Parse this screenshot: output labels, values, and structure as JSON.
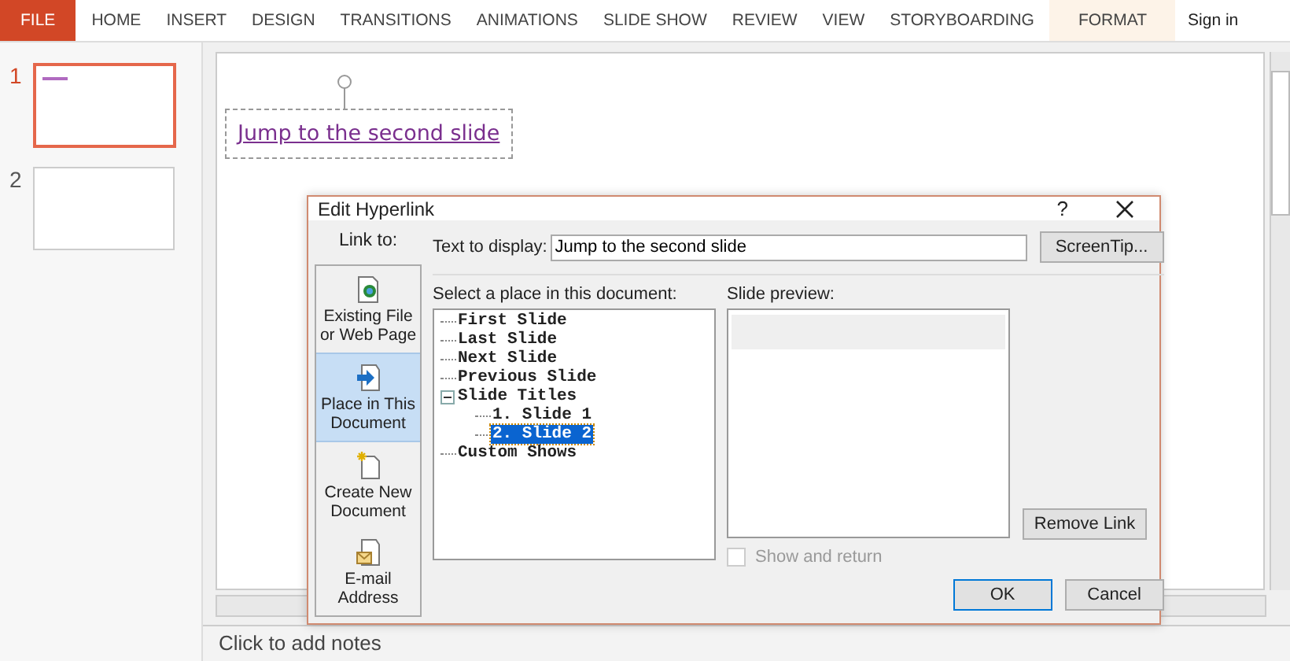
{
  "ribbon": {
    "tabs": [
      {
        "label": "FILE",
        "kind": "file",
        "selected": false
      },
      {
        "label": "HOME",
        "kind": "tab",
        "selected": false
      },
      {
        "label": "INSERT",
        "kind": "tab",
        "selected": false
      },
      {
        "label": "DESIGN",
        "kind": "tab",
        "selected": false
      },
      {
        "label": "TRANSITIONS",
        "kind": "tab",
        "selected": false
      },
      {
        "label": "ANIMATIONS",
        "kind": "tab",
        "selected": false
      },
      {
        "label": "SLIDE SHOW",
        "kind": "tab",
        "selected": false
      },
      {
        "label": "REVIEW",
        "kind": "tab",
        "selected": false
      },
      {
        "label": "VIEW",
        "kind": "tab",
        "selected": false
      },
      {
        "label": "STORYBOARDING",
        "kind": "tab",
        "selected": false
      },
      {
        "label": "FORMAT",
        "kind": "contextual",
        "selected": false
      }
    ],
    "sign_in": "Sign in"
  },
  "thumbnails": [
    {
      "number": "1",
      "selected": true,
      "shows_link": true
    },
    {
      "number": "2",
      "selected": false,
      "shows_link": false
    }
  ],
  "slide": {
    "link_text": "Jump to the second slide"
  },
  "notes": {
    "placeholder": "Click to add notes"
  },
  "dialog": {
    "title": "Edit Hyperlink",
    "help": "?",
    "link_to": {
      "label": "Link to:",
      "options": [
        {
          "label": "Existing File or Web Page",
          "kind": "file",
          "selected": false
        },
        {
          "label": "Place in This Document",
          "kind": "place",
          "selected": true
        },
        {
          "label": "Create New Document",
          "kind": "new",
          "selected": false
        },
        {
          "label": "E-mail Address",
          "kind": "mail",
          "selected": false
        }
      ]
    },
    "text_to_display": {
      "label": "Text to display:",
      "value": "Jump to the second slide"
    },
    "screentip_button": "ScreenTip...",
    "place": {
      "label": "Select a place in this document:",
      "tree": [
        {
          "label": "First Slide",
          "selected": false
        },
        {
          "label": "Last Slide",
          "selected": false
        },
        {
          "label": "Next Slide",
          "selected": false
        },
        {
          "label": "Previous Slide",
          "selected": false
        },
        {
          "label": "Slide Titles",
          "selected": false,
          "expanded": true,
          "children": [
            {
              "label": "1. Slide 1",
              "selected": false
            },
            {
              "label": "2. Slide 2",
              "selected": true
            }
          ]
        },
        {
          "label": "Custom Shows",
          "selected": false
        }
      ]
    },
    "preview": {
      "label": "Slide preview:"
    },
    "show_and_return": {
      "label": "Show and return",
      "checked": false,
      "disabled": true
    },
    "remove_link_button": "Remove Link",
    "ok_button": "OK",
    "cancel_button": "Cancel"
  }
}
